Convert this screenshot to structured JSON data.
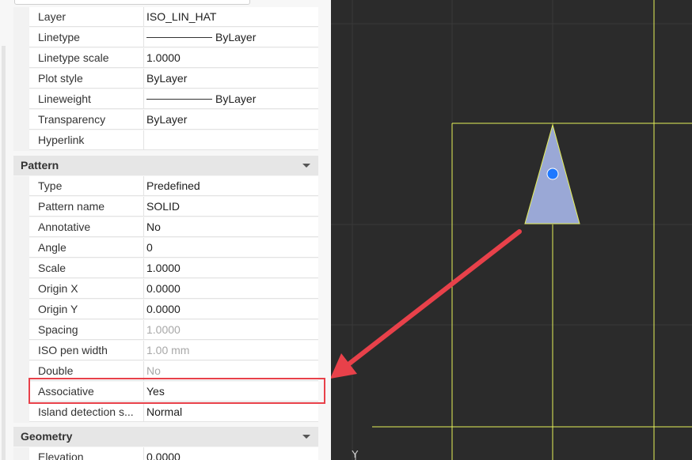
{
  "general_rows": [
    {
      "label": "Layer",
      "value": "ISO_LIN_HAT"
    },
    {
      "label": "Linetype",
      "value": "ByLayer",
      "line_sample": true
    },
    {
      "label": "Linetype scale",
      "value": "1.0000"
    },
    {
      "label": "Plot style",
      "value": "ByLayer"
    },
    {
      "label": "Lineweight",
      "value": "ByLayer",
      "line_sample": true
    },
    {
      "label": "Transparency",
      "value": "ByLayer"
    },
    {
      "label": "Hyperlink",
      "value": ""
    }
  ],
  "pattern_section": {
    "title": "Pattern"
  },
  "pattern_rows": [
    {
      "label": "Type",
      "value": "Predefined"
    },
    {
      "label": "Pattern name",
      "value": "SOLID"
    },
    {
      "label": "Annotative",
      "value": "No"
    },
    {
      "label": "Angle",
      "value": "0"
    },
    {
      "label": "Scale",
      "value": "1.0000"
    },
    {
      "label": "Origin X",
      "value": "0.0000"
    },
    {
      "label": "Origin Y",
      "value": "0.0000"
    },
    {
      "label": "Spacing",
      "value": "1.0000",
      "disabled": true
    },
    {
      "label": "ISO pen width",
      "value": "1.00 mm",
      "disabled": true
    },
    {
      "label": "Double",
      "value": "No",
      "disabled": true
    },
    {
      "label": "Associative",
      "value": "Yes"
    },
    {
      "label": "Island detection s...",
      "value": "Normal"
    }
  ],
  "geometry_section": {
    "title": "Geometry"
  },
  "geometry_rows": [
    {
      "label": "Elevation",
      "value": "0.0000"
    }
  ],
  "viewport": {
    "ucs_label": "Y",
    "colors": {
      "background": "#2b2b2b",
      "boundary": "#e6f05a",
      "grid": "#3a3a3a",
      "hatch_fill": "#9aa8d6",
      "grip": "#1e78ff",
      "annotation": "#e8414a"
    }
  }
}
